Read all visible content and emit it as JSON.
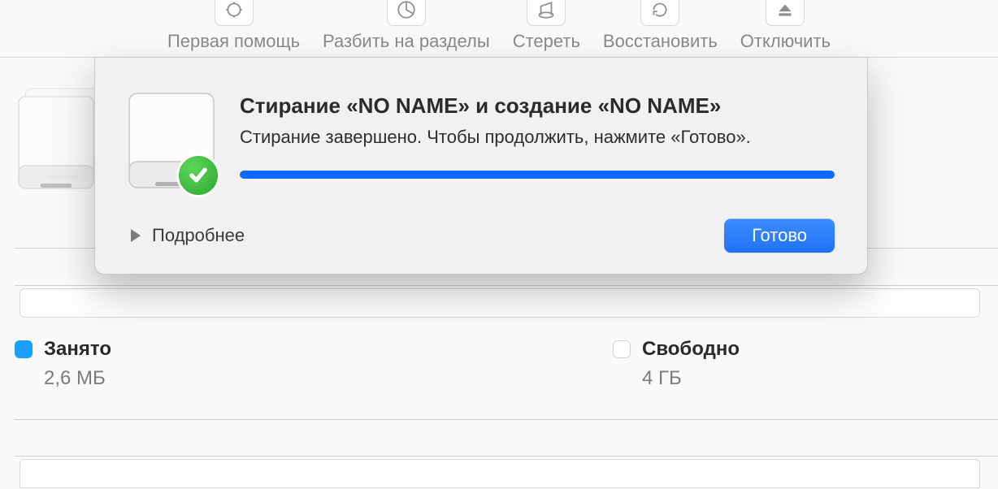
{
  "toolbar": {
    "first_aid": "Первая помощь",
    "partition": "Разбить на разделы",
    "erase": "Стереть",
    "restore": "Восстановить",
    "eject": "Отключить"
  },
  "dialog": {
    "title": "Стирание «NO NAME» и создание «NO NAME»",
    "message": "Стирание завершено. Чтобы продолжить, нажмите «Готово».",
    "details_label": "Подробнее",
    "done_label": "Готово",
    "progress_percent": 100
  },
  "usage": {
    "used": {
      "label": "Занято",
      "value": "2,6 МБ",
      "color": "#199fff"
    },
    "free": {
      "label": "Свободно",
      "value": "4 ГБ",
      "color": "#ffffff"
    }
  }
}
